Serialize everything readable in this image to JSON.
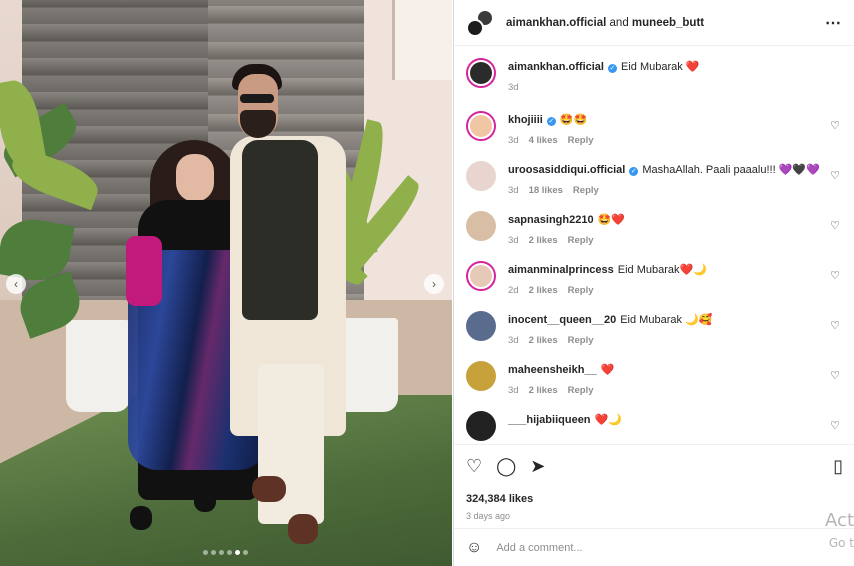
{
  "post": {
    "owners_line_user1": "aimankhan.official",
    "owners_line_and": " and ",
    "owners_line_user2": "muneeb_butt",
    "more_icon": "⋯",
    "carousel": {
      "slide_count": 6,
      "active_index": 4
    }
  },
  "caption": {
    "username": "aimankhan.official",
    "verified": true,
    "text": "Eid Mubarak ❤️",
    "age": "3d"
  },
  "comments": [
    {
      "username": "khojiiii",
      "verified": true,
      "text": "🤩🤩",
      "age": "3d",
      "likes": "4 likes",
      "reply": "Reply",
      "avatar_color": "#f1c6a4"
    },
    {
      "username": "uroosasiddiqui.official",
      "verified": true,
      "text": "MashaAllah. Paali paaalu!!! 💜🖤💜",
      "age": "3d",
      "likes": "18 likes",
      "reply": "Reply",
      "avatar_color": "#e9d5cf"
    },
    {
      "username": "sapnasingh2210",
      "verified": false,
      "text": "🤩❤️",
      "age": "3d",
      "likes": "2 likes",
      "reply": "Reply",
      "avatar_color": "#d8bea5"
    },
    {
      "username": "aimanminalprincess",
      "verified": false,
      "text": "Eid Mubarak❤️🌙",
      "age": "2d",
      "likes": "2 likes",
      "reply": "Reply",
      "avatar_color": "#e6c9b6"
    },
    {
      "username": "inocent__queen__20",
      "verified": false,
      "text": "Eid Mubarak 🌙🥰",
      "age": "3d",
      "likes": "2 likes",
      "reply": "Reply",
      "avatar_color": "#5a6c8e"
    },
    {
      "username": "maheensheikh__",
      "verified": false,
      "text": "❤️",
      "age": "3d",
      "likes": "2 likes",
      "reply": "Reply",
      "avatar_color": "#c7a23a"
    },
    {
      "username": "___hijabiiqueen",
      "verified": false,
      "text": "❤️🌙",
      "age": "",
      "likes": "",
      "reply": "",
      "avatar_color": "#222222"
    }
  ],
  "actions": {
    "like_icon": "♡",
    "comment_icon": "◯",
    "share_icon": "➤",
    "save_icon": "▯",
    "likes_count": "324,384 likes",
    "posted_age": "3 days ago"
  },
  "add_comment": {
    "emoji_icon": "☺",
    "placeholder": "Add a comment..."
  },
  "nav": {
    "prev_icon": "‹",
    "next_icon": "›"
  },
  "overlay": {
    "line1": "Act",
    "line2": "Go t"
  },
  "colors": {
    "link_blue": "#3897f0",
    "story_ring": "#d6249f",
    "muted": "#8e8e8e"
  }
}
